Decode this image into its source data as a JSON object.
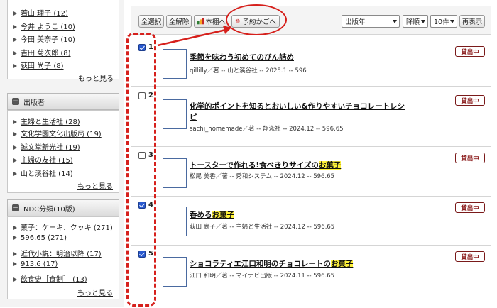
{
  "sidebar": {
    "authors": {
      "items": [
        {
          "label": "若山 理子 (12)"
        },
        {
          "label": "今井 ようこ (10)"
        },
        {
          "label": "今田 美奈子 (10)"
        },
        {
          "label": "吉田 菊次郎 (8)"
        },
        {
          "label": "荻田 尚子 (8)"
        }
      ],
      "more": "もっと見る"
    },
    "publishers": {
      "heading": "出版者",
      "items": [
        {
          "label": "主婦と生活社 (28)"
        },
        {
          "label": "文化学園文化出版局 (19)"
        },
        {
          "label": "誠文堂新光社 (19)"
        },
        {
          "label": "主婦の友社 (15)"
        },
        {
          "label": "山と溪谷社 (14)"
        }
      ],
      "more": "もっと見る"
    },
    "ndc": {
      "heading": "NDC分類(10版)",
      "items": [
        {
          "label": "菓子：ケーキ．クッキ (271)"
        },
        {
          "label": "596.65 (271)"
        },
        {
          "label": "近代小説：明治以降 (17)"
        },
        {
          "label": "913.6 (17)"
        },
        {
          "label": "飲食史［食制］ (13)"
        }
      ],
      "more": "もっと見る"
    }
  },
  "toolbar": {
    "select_all": "全選択",
    "deselect_all": "全解除",
    "bookshelf": "本棚へ",
    "reserve_cart": "予約かごへ",
    "sort_field": "出版年",
    "sort_order": "降順",
    "per_page": "10件",
    "redisplay": "再表示"
  },
  "results": [
    {
      "num": "1",
      "checked": true,
      "title_pre": "季節を味わう初めてのびん詰め",
      "title_hl": "",
      "title_post": "",
      "title_line2": "",
      "meta": "qillilly／著 -- 山と溪谷社 -- 2025.1 -- 596",
      "status": "貸出中"
    },
    {
      "num": "2",
      "checked": false,
      "title_pre": "化学的ポイントを知るとおいしい&作りやすいチョコレートレシ",
      "title_hl": "",
      "title_post": "",
      "title_line2": "ピ",
      "meta": "sachi_homemade／著 -- 翔泳社 -- 2024.12 -- 596.65",
      "status": "貸出中"
    },
    {
      "num": "3",
      "checked": false,
      "title_pre": "トースターで作れる!食べきりサイズの",
      "title_hl": "お菓子",
      "title_post": "",
      "title_line2": "",
      "meta": "松尾 美香／著 -- 秀和システム -- 2024.12 -- 596.65",
      "status": "貸出中"
    },
    {
      "num": "4",
      "checked": true,
      "title_pre": "呑める",
      "title_hl": "お菓子",
      "title_post": "",
      "title_line2": "",
      "meta": "荻田 尚子／著 -- 主婦と生活社 -- 2024.12 -- 596.65",
      "status": "貸出中"
    },
    {
      "num": "5",
      "checked": true,
      "title_pre": "ショコラティエ江口和明のチョコレートの",
      "title_hl": "お菓子",
      "title_post": "",
      "title_line2": "",
      "meta": "江口 和明／著 -- マイナビ出版 -- 2024.11 -- 596.65",
      "status": "貸出中"
    }
  ],
  "colors": {
    "annotation": "#d6201c",
    "badge": "#8a1a1a",
    "highlight": "#fff23a"
  }
}
